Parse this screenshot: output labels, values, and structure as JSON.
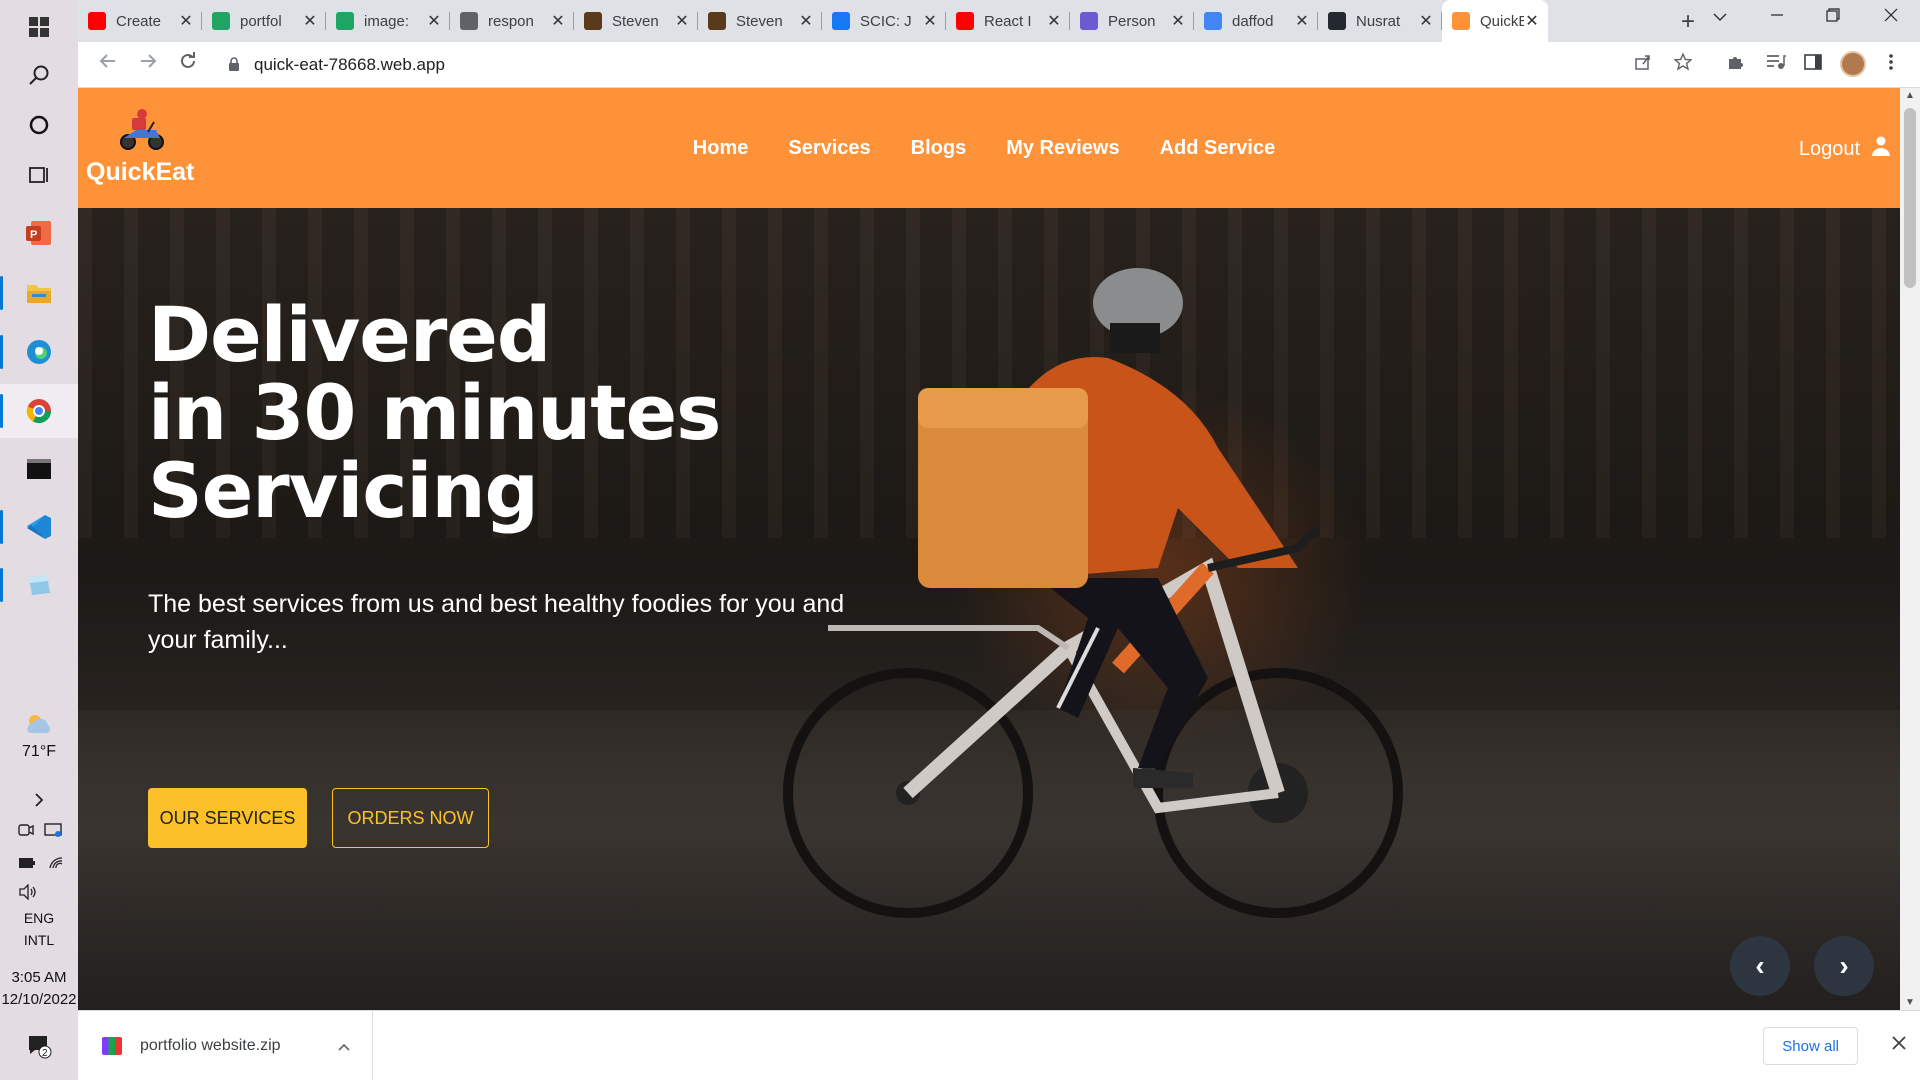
{
  "taskbar": {
    "weather_temp": "71°F",
    "language_line1": "ENG",
    "language_line2": "INTL",
    "time": "3:05 AM",
    "date": "12/10/2022",
    "notification_count": "2"
  },
  "browser": {
    "tabs": [
      {
        "title": "Create",
        "favicon": "youtube-icon",
        "color": "#ff0000"
      },
      {
        "title": "portfol",
        "favicon": "google-drive-icon",
        "color": "#1fa463"
      },
      {
        "title": "image:",
        "favicon": "google-drive-icon",
        "color": "#1fa463"
      },
      {
        "title": "respon",
        "favicon": "globe-icon",
        "color": "#5f6368"
      },
      {
        "title": "Steven",
        "favicon": "book-icon",
        "color": "#5a3a1a"
      },
      {
        "title": "Steven",
        "favicon": "book-icon",
        "color": "#5a3a1a"
      },
      {
        "title": "SCIC: J",
        "favicon": "facebook-icon",
        "color": "#1877f2"
      },
      {
        "title": "React I",
        "favicon": "youtube-icon",
        "color": "#ff0000"
      },
      {
        "title": "Person",
        "favicon": "notion-icon",
        "color": "#6b5bd2"
      },
      {
        "title": "daffod",
        "favicon": "google-icon",
        "color": "#4285f4"
      },
      {
        "title": "Nusrat",
        "favicon": "github-icon",
        "color": "#24292f"
      },
      {
        "title": "QuickE",
        "favicon": "quickeat-icon",
        "color": "#fd9238"
      }
    ],
    "url": "quick-eat-78668.web.app"
  },
  "site": {
    "brand": "QuickEat",
    "nav": {
      "home": "Home",
      "services": "Services",
      "blogs": "Blogs",
      "my_reviews": "My Reviews",
      "add_service": "Add Service"
    },
    "logout": "Logout",
    "colors": {
      "nav_bg": "#fd9238",
      "accent": "#fcc129"
    },
    "hero": {
      "title_line1": "Delivered",
      "title_line2": "in 30 minutes",
      "title_line3": "Servicing",
      "subtitle": "The best services from us and best healthy foodies for you and your family...",
      "btn_services": "OUR SERVICES",
      "btn_orders": "ORDERS NOW",
      "prev": "‹",
      "next": "›"
    }
  },
  "downloads": {
    "file_name": "portfolio website.zip",
    "show_all": "Show all"
  }
}
